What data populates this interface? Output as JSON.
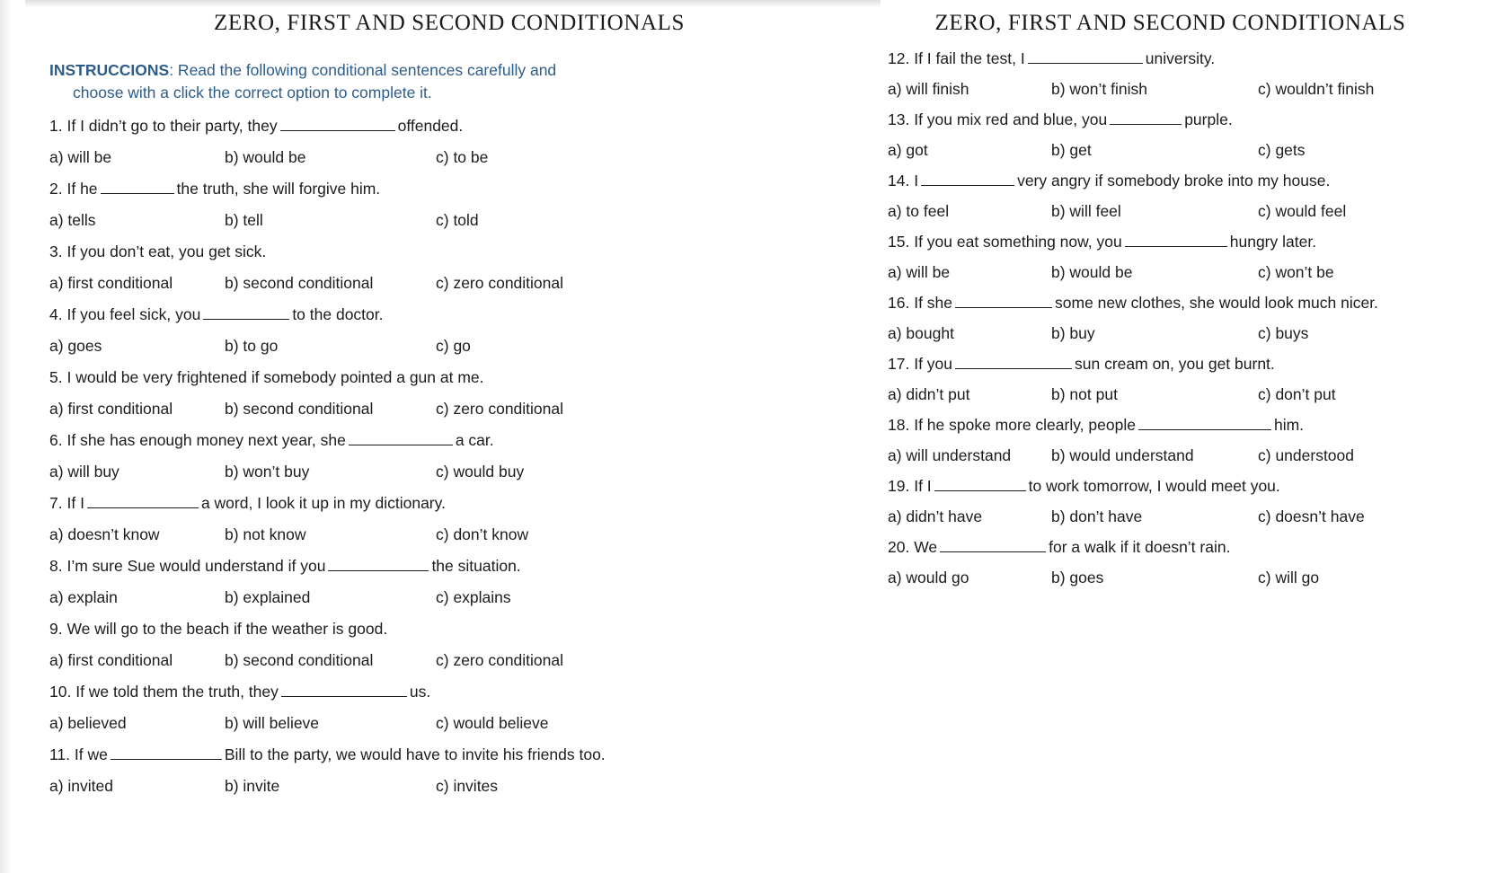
{
  "document": {
    "title": "ZERO, FIRST AND SECOND CONDITIONALS",
    "instructions_lead": "INSTRUCCIONS",
    "instructions_line1": ": Read the following conditional sentences carefully and",
    "instructions_line2": "choose with a click the correct option to complete it.",
    "instructions_color": "#2e5c8a"
  },
  "pages": [
    {
      "title": "ZERO, FIRST AND SECOND CONDITIONALS",
      "questions": [
        {
          "number": "1.",
          "parts": [
            "If I didn’t go to their party, they",
            "offended."
          ],
          "blank_width": 128,
          "options": [
            "a) will be",
            "b) would be",
            "c) to be"
          ]
        },
        {
          "number": "2.",
          "parts": [
            "If he",
            "the truth, she will forgive him."
          ],
          "blank_width": 82,
          "options": [
            "a) tells",
            "b) tell",
            "c) told"
          ]
        },
        {
          "number": "3.",
          "parts": [
            "If you don’t eat, you get sick."
          ],
          "blank_width": 0,
          "options": [
            "a) first conditional",
            "b) second conditional",
            "c) zero conditional"
          ]
        },
        {
          "number": "4.",
          "parts": [
            "If you feel sick, you",
            "to the doctor."
          ],
          "blank_width": 96,
          "options": [
            "a) goes",
            "b) to go",
            "c) go"
          ]
        },
        {
          "number": "5.",
          "parts": [
            "I would be very frightened if somebody pointed a gun at me."
          ],
          "blank_width": 0,
          "options": [
            "a) first conditional",
            "b) second conditional",
            "c) zero conditional"
          ]
        },
        {
          "number": "6.",
          "parts": [
            "If she has enough money next year, she",
            "a car."
          ],
          "blank_width": 116,
          "options": [
            "a) will buy",
            "b) won’t buy",
            "c) would buy"
          ]
        },
        {
          "number": "7.",
          "parts": [
            "If I",
            "a word, I look it up in my dictionary."
          ],
          "blank_width": 124,
          "options": [
            "a) doesn’t know",
            "b) not know",
            "c) don’t know"
          ]
        },
        {
          "number": "8.",
          "parts": [
            "I’m sure Sue would understand if you",
            "the situation."
          ],
          "blank_width": 112,
          "options": [
            "a) explain",
            "b) explained",
            "c) explains"
          ]
        },
        {
          "number": "9.",
          "parts": [
            "We will go to the beach if the weather is good."
          ],
          "blank_width": 0,
          "options": [
            "a) first conditional",
            "b) second conditional",
            "c) zero conditional"
          ]
        },
        {
          "number": "10.",
          "parts": [
            "If we told them the truth, they",
            "us."
          ],
          "blank_width": 140,
          "options": [
            "a) believed",
            "b) will believe",
            "c) would believe"
          ]
        },
        {
          "number": "11.",
          "parts": [
            "If we",
            "Bill to the party, we would have to invite his friends too."
          ],
          "blank_width": 124,
          "options": [
            "a) invited",
            "b) invite",
            "c) invites"
          ]
        }
      ]
    },
    {
      "title": "ZERO, FIRST AND SECOND CONDITIONALS",
      "questions": [
        {
          "number": "12.",
          "parts": [
            "If I fail the test, I",
            "university."
          ],
          "blank_width": 128,
          "options": [
            "a) will finish",
            "b) won’t finish",
            "c) wouldn’t finish"
          ]
        },
        {
          "number": "13.",
          "parts": [
            "If you mix red and blue, you",
            "purple."
          ],
          "blank_width": 80,
          "options": [
            "a) got",
            "b) get",
            "c) gets"
          ]
        },
        {
          "number": "14.",
          "parts": [
            "I",
            "very angry if somebody broke into my house."
          ],
          "blank_width": 104,
          "options": [
            "a) to feel",
            "b) will feel",
            "c) would feel"
          ]
        },
        {
          "number": "15.",
          "parts": [
            "If you eat something now, you",
            "hungry later."
          ],
          "blank_width": 114,
          "options": [
            "a) will be",
            "b) would be",
            "c) won’t be"
          ]
        },
        {
          "number": "16.",
          "parts": [
            "If she",
            "some new clothes, she would look much nicer."
          ],
          "blank_width": 108,
          "options": [
            "a) bought",
            "b) buy",
            "c) buys"
          ]
        },
        {
          "number": "17.",
          "parts": [
            "If you",
            "sun cream on, you get burnt."
          ],
          "blank_width": 130,
          "options": [
            "a) didn’t put",
            "b) not put",
            "c) don’t put"
          ]
        },
        {
          "number": "18.",
          "parts": [
            "If he spoke more clearly, people",
            "him."
          ],
          "blank_width": 148,
          "options": [
            "a) will understand",
            "b) would understand",
            "c) understood"
          ]
        },
        {
          "number": "19.",
          "parts": [
            "If I",
            "to work tomorrow, I would meet you."
          ],
          "blank_width": 102,
          "options": [
            "a) didn’t have",
            "b) don’t have",
            "c) doesn’t have"
          ]
        },
        {
          "number": "20.",
          "parts": [
            "We",
            "for a walk if it doesn’t rain."
          ],
          "blank_width": 118,
          "options": [
            "a) would go",
            "b) goes",
            "c) will go"
          ]
        }
      ]
    }
  ]
}
